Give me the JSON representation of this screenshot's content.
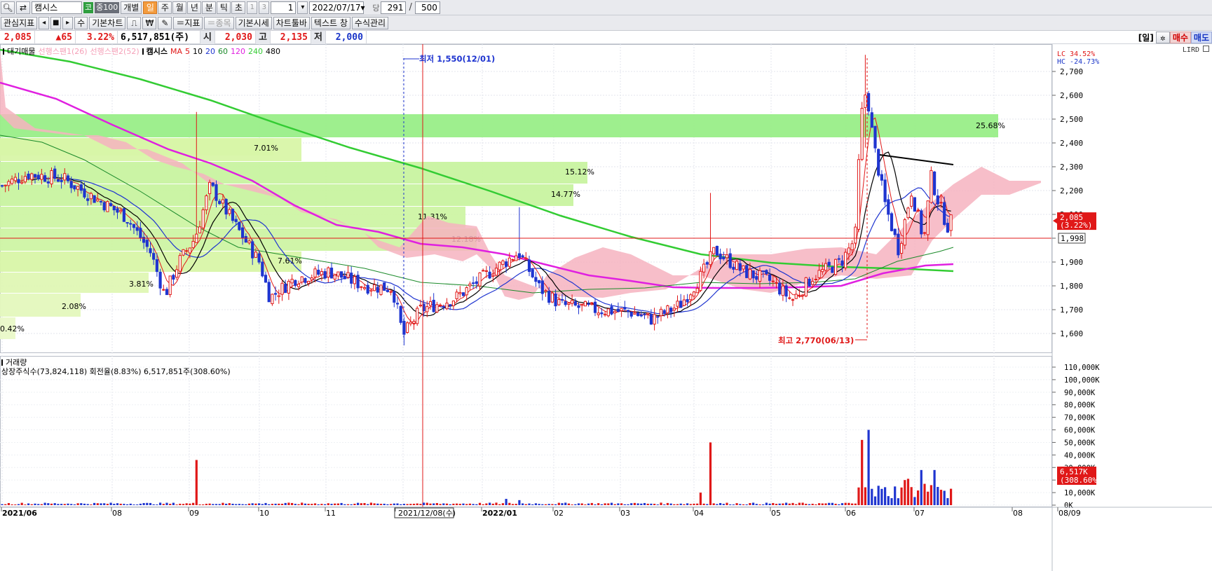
{
  "toolbar1": {
    "stock_name": "캠시스",
    "market_tag": "코",
    "index_tag": "중100",
    "individual": "개별",
    "periods": [
      "일",
      "주",
      "월",
      "년",
      "분",
      "틱",
      "초"
    ],
    "period_active": "일",
    "num1": "1",
    "num2": "3",
    "unit_value": "1",
    "date": "2022/07/17",
    "count_label": "당",
    "count_value": "291",
    "count_total": "500"
  },
  "toolbar2": {
    "interest": "관심지표",
    "number_label": "수",
    "basic_chart": "기본차트",
    "minus_indicator": "＝지표",
    "minus_item": "＝종목",
    "basic_quote": "기본시세",
    "chart_toolbar": "차트툴바",
    "text_window": "텍스트 창",
    "formula_mgmt": "수식관리"
  },
  "infobar": {
    "price": "2,085",
    "change": "▲65",
    "change_pct": "3.22%",
    "volume": "6,517,851(주)",
    "open_label": "시",
    "open": "2,030",
    "high_label": "고",
    "high": "2,135",
    "low_label": "저",
    "low": "2,000",
    "period_label": "[일]",
    "buy": "매수",
    "sell": "매도"
  },
  "legend": {
    "main": "대기매물",
    "span1": "선행스팬1(26)",
    "span2": "선행스팬2(52)",
    "stock": "캠시스",
    "ma_label": "MA",
    "ma": [
      {
        "n": "5",
        "color": "#e01818"
      },
      {
        "n": "10",
        "color": "#000000"
      },
      {
        "n": "20",
        "color": "#1f35d0"
      },
      {
        "n": "60",
        "color": "#1b8a2a"
      },
      {
        "n": "120",
        "color": "#e020e0"
      },
      {
        "n": "240",
        "color": "#33cc33"
      },
      {
        "n": "480",
        "color": "#000000"
      }
    ]
  },
  "chart_data": {
    "type": "candlestick",
    "stock": "캠시스",
    "price_axis": [
      "2,700",
      "2,600",
      "2,500",
      "2,400",
      "2,300",
      "2,200",
      "2,100",
      "2,000",
      "1,900",
      "1,800",
      "1,700",
      "1,600"
    ],
    "price_ylim": [
      1550,
      2770
    ],
    "volume_axis": [
      "110,000K",
      "100,000K",
      "90,000K",
      "80,000K",
      "70,000K",
      "60,000K",
      "50,000K",
      "40,000K",
      "30,000K",
      "20,000K",
      "10,000K",
      "0K"
    ],
    "x_axis": [
      "2021/06",
      "08",
      "09",
      "10",
      "11",
      "2021/12/08(수)",
      "2022/01",
      "02",
      "03",
      "04",
      "05",
      "06",
      "07",
      "08",
      "08/09"
    ],
    "volume_profile_pct": [
      "25.68%",
      "15.12%",
      "14.77%",
      "11.31%",
      "12.18%",
      "7.01%",
      "7.61%",
      "3.81%",
      "2.08%",
      "0.42%"
    ],
    "annotations": {
      "low": "최저 1,550(12/01)",
      "high": "최고 2,770(06/13)"
    },
    "price_label": "2,085",
    "price_label_pct": "(3.22%)",
    "line_value": "1,998",
    "lc": "LC  34.52%",
    "hc": "HC -24.73%",
    "volume_title": "거래량",
    "volume_info": "상장주식수(73,824,118) 회전율(8.83%) 6,517,851주(308.60%)",
    "volume_label": "6,517K",
    "volume_label_pct": "(308.60%)",
    "lird": "LIRD"
  }
}
